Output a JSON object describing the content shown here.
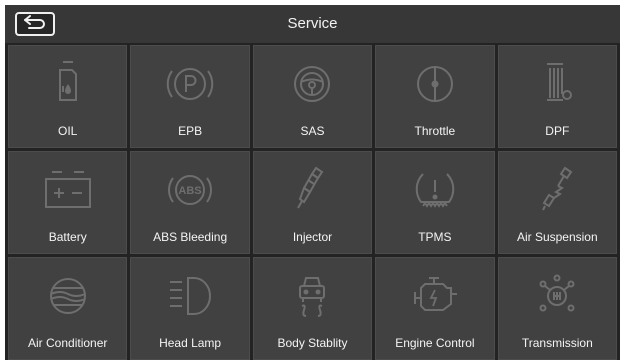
{
  "header": {
    "title": "Service",
    "back_icon": "back-arrow-icon"
  },
  "tiles": [
    {
      "label": "OIL",
      "icon": "oil-can-icon"
    },
    {
      "label": "EPB",
      "icon": "parking-brake-icon"
    },
    {
      "label": "SAS",
      "icon": "steering-wheel-icon"
    },
    {
      "label": "Throttle",
      "icon": "throttle-icon"
    },
    {
      "label": "DPF",
      "icon": "diesel-filter-icon"
    },
    {
      "label": "Battery",
      "icon": "battery-icon"
    },
    {
      "label": "ABS Bleeding",
      "icon": "abs-icon"
    },
    {
      "label": "Injector",
      "icon": "injector-icon"
    },
    {
      "label": "TPMS",
      "icon": "tire-pressure-icon"
    },
    {
      "label": "Air Suspension",
      "icon": "air-suspension-icon"
    },
    {
      "label": "Air Conditioner",
      "icon": "air-conditioner-icon"
    },
    {
      "label": "Head Lamp",
      "icon": "head-lamp-icon"
    },
    {
      "label": "Body Stablity",
      "icon": "body-stability-icon"
    },
    {
      "label": "Engine Control",
      "icon": "engine-icon"
    },
    {
      "label": "Transmission",
      "icon": "gearbox-icon"
    }
  ],
  "colors": {
    "background": "#232323",
    "header": "#373737",
    "tile": "#414141",
    "icon": "#6e6e6e",
    "text": "#f4f4f4"
  }
}
